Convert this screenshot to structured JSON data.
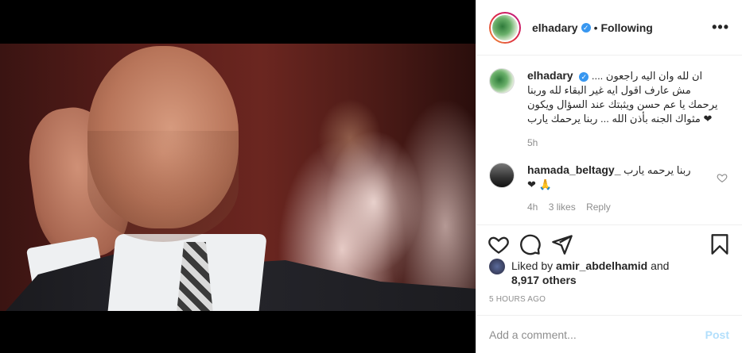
{
  "header": {
    "username": "elhadary",
    "separator": "•",
    "follow_label": "Following",
    "more_label": "•••"
  },
  "caption": {
    "username": "elhadary",
    "text": "ان لله وان اليه راجعون .... مش عارف اقول ايه غير البقاء لله وربنا يرحمك يا عم حسن ويثبتك عند السؤال ويكون مثواك الجنه بأذن الله ... ربنا يرحمك يارب ❤",
    "time": "5h"
  },
  "comment": {
    "username": "hamada_beltagy_",
    "text": "ربنا يرحمه يارب ❤ 🙏",
    "time": "4h",
    "likes": "3 likes",
    "reply": "Reply"
  },
  "likes": {
    "prefix": "Liked by",
    "user": "amir_abdelhamid",
    "and": "and",
    "count": "8,917 others"
  },
  "timestamp": "5 HOURS AGO",
  "add_comment": {
    "placeholder": "Add a comment...",
    "post_label": "Post"
  },
  "icons": [
    "heart-icon",
    "comment-icon",
    "share-icon",
    "bookmark-icon",
    "verified-icon",
    "more-icon"
  ],
  "colors": {
    "verified": "#3897f0",
    "post_disabled": "#b2dffc",
    "muted": "#8e8e8e"
  }
}
